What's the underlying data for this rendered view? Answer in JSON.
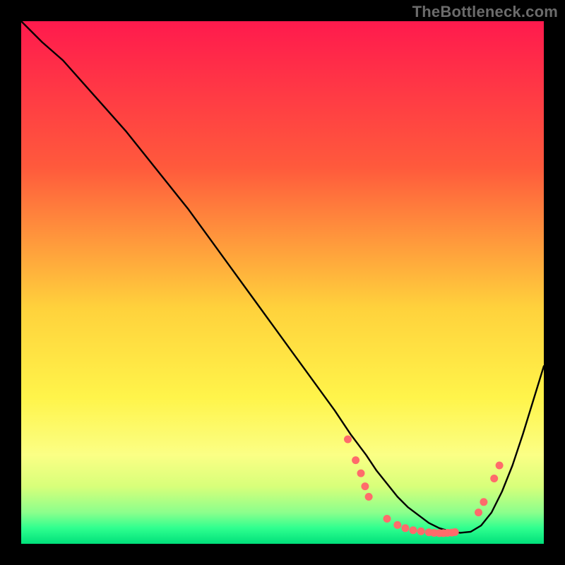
{
  "watermark": "TheBottleneck.com",
  "chart_data": {
    "type": "line",
    "title": "",
    "xlabel": "",
    "ylabel": "",
    "xlim": [
      0,
      100
    ],
    "ylim": [
      0,
      100
    ],
    "gradient_stops": [
      {
        "offset": 0,
        "color": "#ff1a4d"
      },
      {
        "offset": 28,
        "color": "#ff5a3c"
      },
      {
        "offset": 55,
        "color": "#ffd23c"
      },
      {
        "offset": 72,
        "color": "#fff44a"
      },
      {
        "offset": 83,
        "color": "#fbff85"
      },
      {
        "offset": 89,
        "color": "#d8ff7a"
      },
      {
        "offset": 94,
        "color": "#8cff8c"
      },
      {
        "offset": 97,
        "color": "#2fff8f"
      },
      {
        "offset": 100,
        "color": "#00e07a"
      }
    ],
    "series": [
      {
        "name": "bottleneck-curve",
        "x": [
          0,
          4,
          8,
          12,
          16,
          20,
          24,
          28,
          32,
          36,
          40,
          44,
          48,
          52,
          56,
          60,
          63,
          66,
          68,
          70,
          72,
          74,
          76,
          78,
          80,
          82,
          84,
          86,
          88,
          90,
          92,
          94,
          96,
          98,
          100
        ],
        "values": [
          100,
          96,
          92.5,
          88,
          83.5,
          79,
          74,
          69,
          64,
          58.5,
          53,
          47.5,
          42,
          36.5,
          31,
          25.5,
          21,
          17,
          14,
          11.5,
          9,
          7,
          5.5,
          4,
          3,
          2.4,
          2.1,
          2.3,
          3.5,
          6,
          10,
          15,
          21,
          27.5,
          34
        ]
      }
    ],
    "markers": {
      "name": "highlight-points",
      "color": "#ff6b6b",
      "radius": 5.5,
      "points": [
        {
          "x": 62.5,
          "y": 20.0
        },
        {
          "x": 64.0,
          "y": 16.0
        },
        {
          "x": 65.0,
          "y": 13.5
        },
        {
          "x": 65.8,
          "y": 11.0
        },
        {
          "x": 66.5,
          "y": 9.0
        },
        {
          "x": 70.0,
          "y": 4.8
        },
        {
          "x": 72.0,
          "y": 3.6
        },
        {
          "x": 73.5,
          "y": 3.0
        },
        {
          "x": 75.0,
          "y": 2.6
        },
        {
          "x": 76.5,
          "y": 2.4
        },
        {
          "x": 78.0,
          "y": 2.2
        },
        {
          "x": 79.0,
          "y": 2.1
        },
        {
          "x": 80.0,
          "y": 2.05
        },
        {
          "x": 80.8,
          "y": 2.05
        },
        {
          "x": 81.6,
          "y": 2.1
        },
        {
          "x": 82.4,
          "y": 2.15
        },
        {
          "x": 83.0,
          "y": 2.25
        },
        {
          "x": 87.5,
          "y": 6.0
        },
        {
          "x": 88.5,
          "y": 8.0
        },
        {
          "x": 90.5,
          "y": 12.5
        },
        {
          "x": 91.5,
          "y": 15.0
        }
      ]
    }
  }
}
